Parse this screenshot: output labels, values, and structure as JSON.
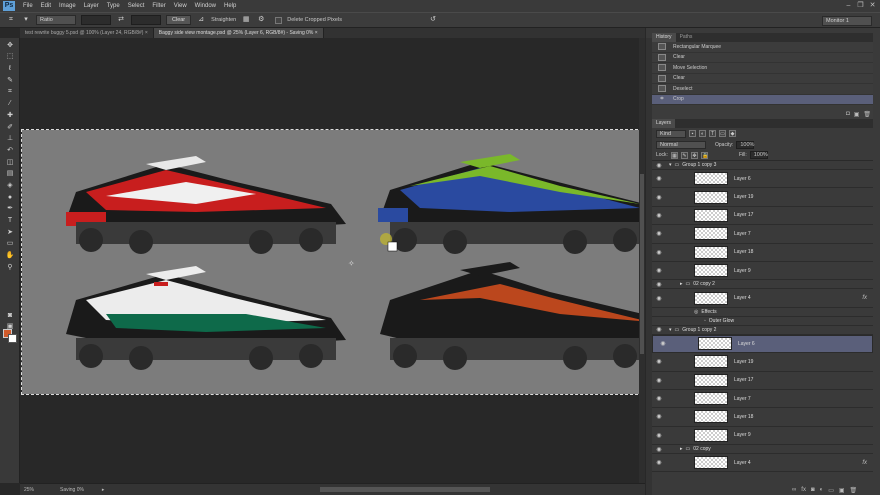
{
  "menubar": {
    "logo": "Ps",
    "items": [
      "File",
      "Edit",
      "Image",
      "Layer",
      "Type",
      "Select",
      "Filter",
      "View",
      "Window",
      "Help"
    ]
  },
  "options": {
    "ratio": "Ratio",
    "clear": "Clear",
    "straighten": "Straighten",
    "delete_cropped": "Delete Cropped Pixels",
    "monitor": "Monitor 1"
  },
  "tabs": [
    "test rewrite buggy 5.psd @ 100% (Layer 24, RGB/8#)",
    "Baggy side view montage.psd @ 25% (Layer 6, RGB/8#) - Saving 0%"
  ],
  "status": {
    "zoom": "25%",
    "saving": "Saving 0%"
  },
  "history": {
    "tabs": [
      "History",
      "Paths"
    ],
    "items": [
      "Rectangular Marquee",
      "Clear",
      "Move Selection",
      "Clear",
      "Deselect",
      "Crop"
    ]
  },
  "layers": {
    "tab": "Layers",
    "kind": "Kind",
    "blend": "Normal",
    "opacity_label": "Opacity:",
    "opacity": "100%",
    "lock_label": "Lock:",
    "fill_label": "Fill:",
    "fill": "100%",
    "rows": [
      {
        "kind": "group",
        "name": "Group 1 copy 3"
      },
      {
        "kind": "layer",
        "name": "Layer 6"
      },
      {
        "kind": "layer",
        "name": "Layer 19"
      },
      {
        "kind": "layer",
        "name": "Layer 17"
      },
      {
        "kind": "layer",
        "name": "Layer 7"
      },
      {
        "kind": "layer",
        "name": "Layer 18"
      },
      {
        "kind": "layer",
        "name": "Layer 9"
      },
      {
        "kind": "group",
        "name": "02 copy 2"
      },
      {
        "kind": "layer",
        "name": "Layer 4",
        "fx": "fx"
      },
      {
        "kind": "effect",
        "name": "Effects"
      },
      {
        "kind": "effect2",
        "name": "Outer Glow"
      },
      {
        "kind": "group",
        "name": "Group 1 copy 2"
      },
      {
        "kind": "layer",
        "name": "Layer 6",
        "selected": true
      },
      {
        "kind": "layer",
        "name": "Layer 19"
      },
      {
        "kind": "layer",
        "name": "Layer 17"
      },
      {
        "kind": "layer",
        "name": "Layer 7"
      },
      {
        "kind": "layer",
        "name": "Layer 18"
      },
      {
        "kind": "layer",
        "name": "Layer 9"
      },
      {
        "kind": "group",
        "name": "02 copy"
      },
      {
        "kind": "layer",
        "name": "Layer 4",
        "fx": "fx"
      }
    ]
  },
  "colors": {
    "accent_select": "#5a5f7a",
    "foreground": "#d05a2a",
    "background": "#ffffff",
    "buggy_red": "#c81e1e",
    "buggy_green": "#7ab82a",
    "buggy_blue": "#2a4aa0",
    "buggy_teal": "#0e6a4a",
    "buggy_orange": "#d8501e"
  }
}
